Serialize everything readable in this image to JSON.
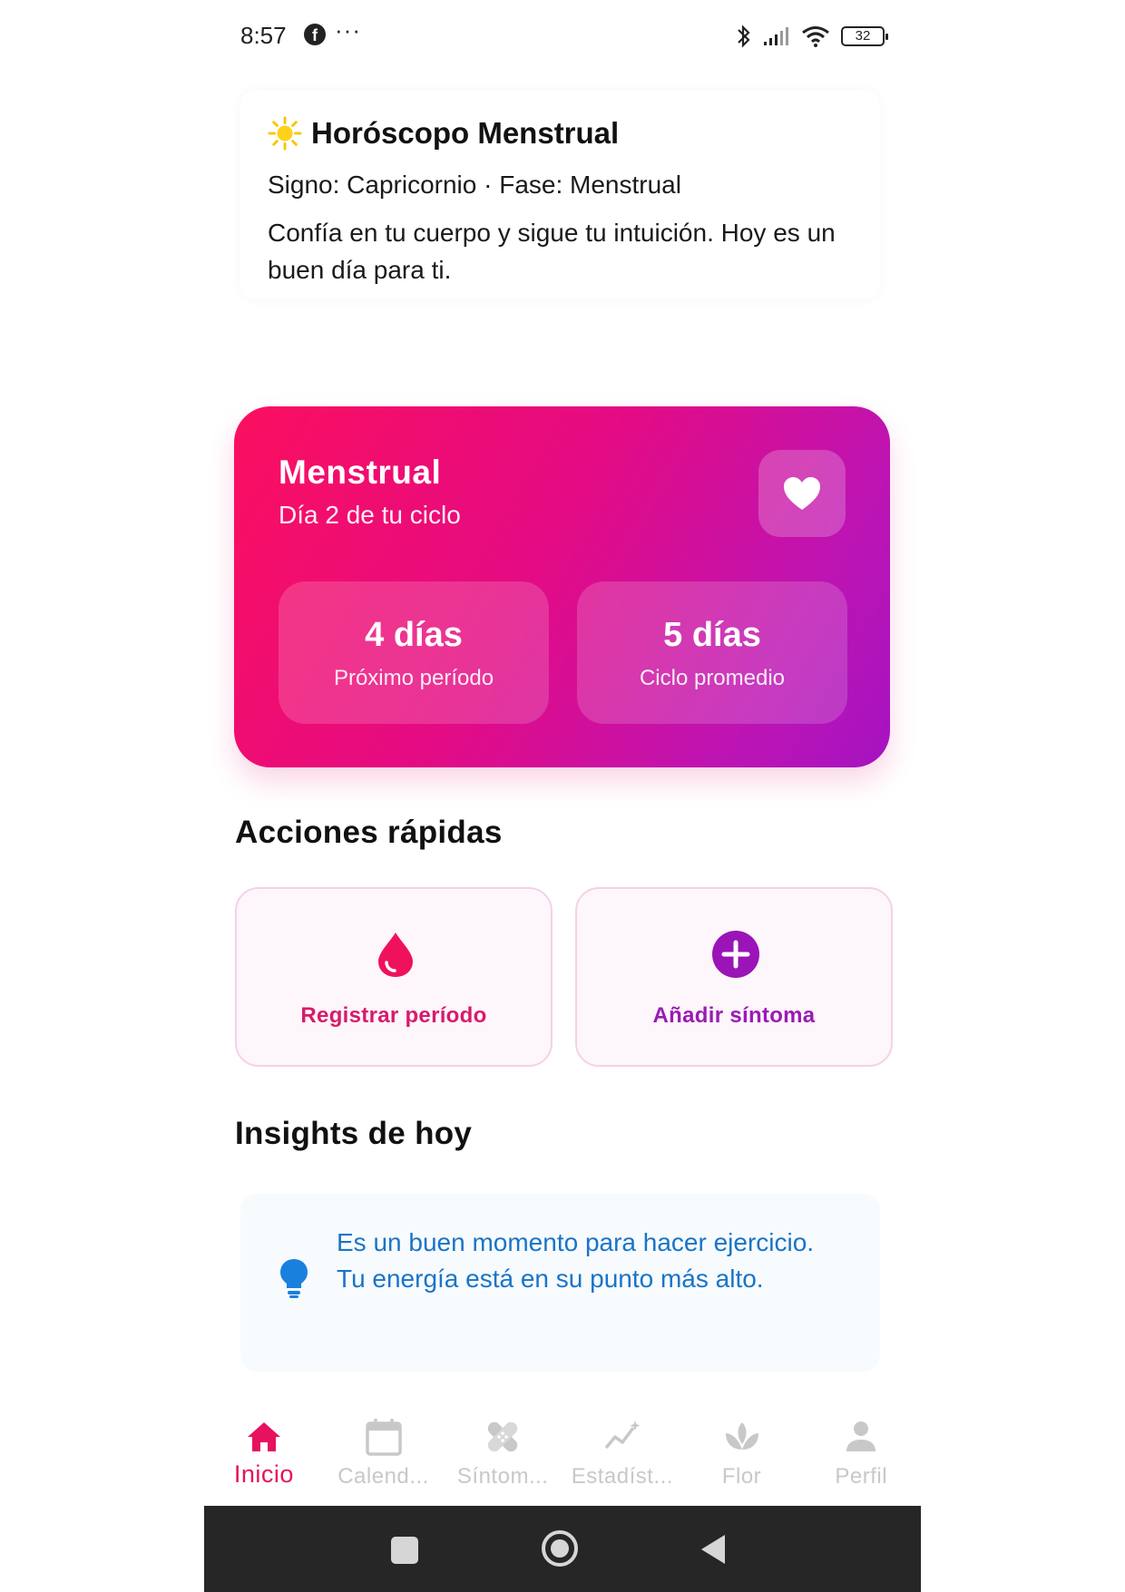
{
  "status_bar": {
    "time": "8:57",
    "dots": "···",
    "battery": "32"
  },
  "horoscope": {
    "icon": "sun-icon",
    "title": "Horóscopo Menstrual",
    "sign_line": "Signo: Capricornio · Fase: Menstrual",
    "message": "Confía en tu cuerpo y sigue tu intuición. Hoy es un buen día para ti."
  },
  "cycle_card": {
    "phase": "Menstrual",
    "day_text": "Día 2 de tu ciclo",
    "heart_icon": "heart-icon",
    "stats": [
      {
        "value": "4 días",
        "label": "Próximo período"
      },
      {
        "value": "5 días",
        "label": "Ciclo promedio"
      }
    ],
    "gradient_colors": [
      "#fb0f5f",
      "#e40b83",
      "#a513c1"
    ]
  },
  "quick_actions": {
    "title": "Acciones rápidas",
    "items": [
      {
        "label": "Registrar período",
        "icon": "drop-icon",
        "color": "#e8115f"
      },
      {
        "label": "Añadir síntoma",
        "icon": "plus-circle-icon",
        "color": "#9b1ab5"
      }
    ]
  },
  "insights": {
    "title": "Insights de hoy",
    "icon": "lightbulb-icon",
    "text": "Es un buen momento para hacer ejercicio. Tu energía está en su punto más alto.",
    "color": "#1a74c7"
  },
  "bottom_nav": {
    "items": [
      {
        "label": "Inicio",
        "icon": "home-icon",
        "active": true
      },
      {
        "label": "Calend...",
        "icon": "calendar-icon",
        "active": false
      },
      {
        "label": "Síntom...",
        "icon": "bandage-icon",
        "active": false
      },
      {
        "label": "Estadíst...",
        "icon": "stats-icon",
        "active": false
      },
      {
        "label": "Flor",
        "icon": "lotus-icon",
        "active": false
      },
      {
        "label": "Perfil",
        "icon": "person-icon",
        "active": false
      }
    ],
    "active_color": "#e6115f",
    "inactive_color": "#c8c8c8"
  }
}
